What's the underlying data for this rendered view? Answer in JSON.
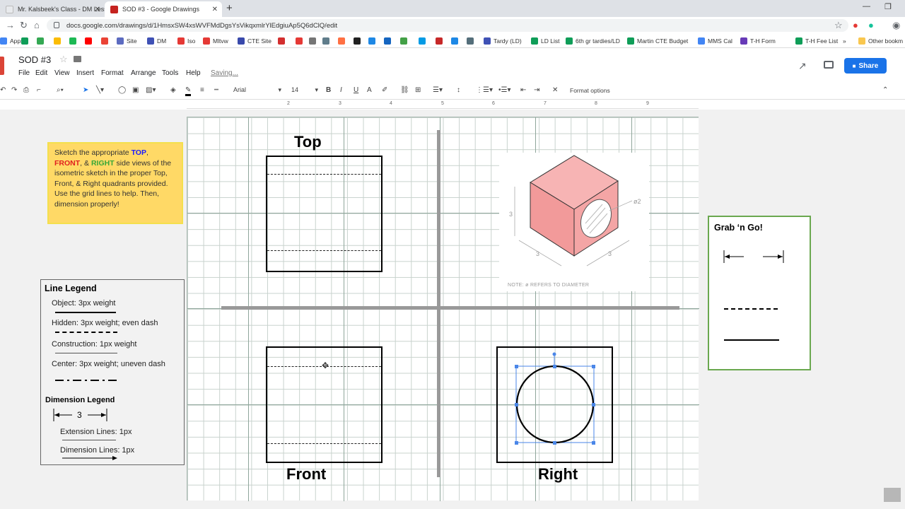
{
  "browser": {
    "tabs": [
      {
        "label": "Mr. Kalsbeek's Class - DM Lesson",
        "active": false
      },
      {
        "label": "SOD #3 - Google Drawings",
        "active": true
      }
    ],
    "new_tab": "+",
    "url": "docs.google.com/drawings/d/1HmsxSW4xsWVFMdDgsYsVikqxmlrYlEdgiuAp5Q6dClQ/edit",
    "bookmarks": [
      {
        "label": "Apps",
        "color": "#4285f4"
      },
      {
        "label": "",
        "color": "#0f9d58"
      },
      {
        "label": "",
        "color": "#34a853"
      },
      {
        "label": "",
        "color": "#fbbc04"
      },
      {
        "label": "",
        "color": "#1db954"
      },
      {
        "label": "",
        "color": "#ff0000"
      },
      {
        "label": "",
        "color": "#ea4335"
      },
      {
        "label": "Site",
        "color": "#5c6bc0"
      },
      {
        "label": "DM",
        "color": "#3f51b5"
      },
      {
        "label": "Iso",
        "color": "#e53935"
      },
      {
        "label": "Mltvw",
        "color": "#e53935"
      },
      {
        "label": "CTE Site",
        "color": "#3949ab"
      },
      {
        "label": "",
        "color": "#d32f2f"
      },
      {
        "label": "",
        "color": "#e53935"
      },
      {
        "label": "",
        "color": "#757575"
      },
      {
        "label": "",
        "color": "#607d8b"
      },
      {
        "label": "",
        "color": "#ff7043"
      },
      {
        "label": "",
        "color": "#212121"
      },
      {
        "label": "",
        "color": "#1e88e5"
      },
      {
        "label": "",
        "color": "#1565c0"
      },
      {
        "label": "",
        "color": "#43a047"
      },
      {
        "label": "",
        "color": "#039be5"
      },
      {
        "label": "",
        "color": "#c62828"
      },
      {
        "label": "",
        "color": "#1e88e5"
      },
      {
        "label": "",
        "color": "#546e7a"
      },
      {
        "label": "Tardy (LD)",
        "color": "#3f51b5"
      },
      {
        "label": "LD List",
        "color": "#0f9d58"
      },
      {
        "label": "6th gr tardies/LD",
        "color": "#0f9d58"
      },
      {
        "label": "Martin CTE Budget",
        "color": "#0f9d58"
      },
      {
        "label": "MMS Cal",
        "color": "#4285f4"
      },
      {
        "label": "T-H Form",
        "color": "#673ab7"
      },
      {
        "label": "T-H Fee List",
        "color": "#0f9d58"
      }
    ],
    "more_bookmarks": "»",
    "other_bookmarks": "Other bookm"
  },
  "doc": {
    "title": "SOD #3",
    "menus": [
      "File",
      "Edit",
      "View",
      "Insert",
      "Format",
      "Arrange",
      "Tools",
      "Help"
    ],
    "saving": "Saving...",
    "share_label": "Share"
  },
  "toolbar": {
    "font_family": "Arial",
    "font_size": "14",
    "format_options": "Format options"
  },
  "ruler": {
    "marks": [
      "2",
      "3",
      "4",
      "5",
      "6",
      "7",
      "8",
      "9"
    ]
  },
  "canvas": {
    "labels": {
      "top": "Top",
      "front": "Front",
      "right": "Right"
    },
    "iso": {
      "dim_a": "3",
      "dim_b": "3",
      "dim_c": "3",
      "hole": "ø2",
      "note": "NOTE: ø REFERS TO DIAMETER"
    }
  },
  "instructions": {
    "p1": "Sketch the appropriate ",
    "top": "TOP",
    "p2": ",",
    "front": "FRONT",
    "p3": ", & ",
    "right": "RIGHT",
    "p4": " side views of the isometric sketch in the proper Top, Front, & Right quadrants provided. Use the grid lines to help. Then, dimension properly!"
  },
  "legend": {
    "title": "Line Legend",
    "object": "Object: 3px weight",
    "hidden": "Hidden: 3px weight; even dash",
    "construction": "Construction: 1px weight",
    "center": "Center: 3px weight; uneven dash",
    "dim_title": "Dimension Legend",
    "dim_value": "3",
    "extension": "Extension Lines: 1px",
    "dimension": "Dimension Lines: 1px"
  },
  "grab": {
    "title": "Grab ‘n Go!"
  },
  "colors": {
    "share": "#1a73e8",
    "note_bg": "#ffd966",
    "grab_border": "#6aa84f",
    "cube_fill": "#f4a5a5"
  }
}
